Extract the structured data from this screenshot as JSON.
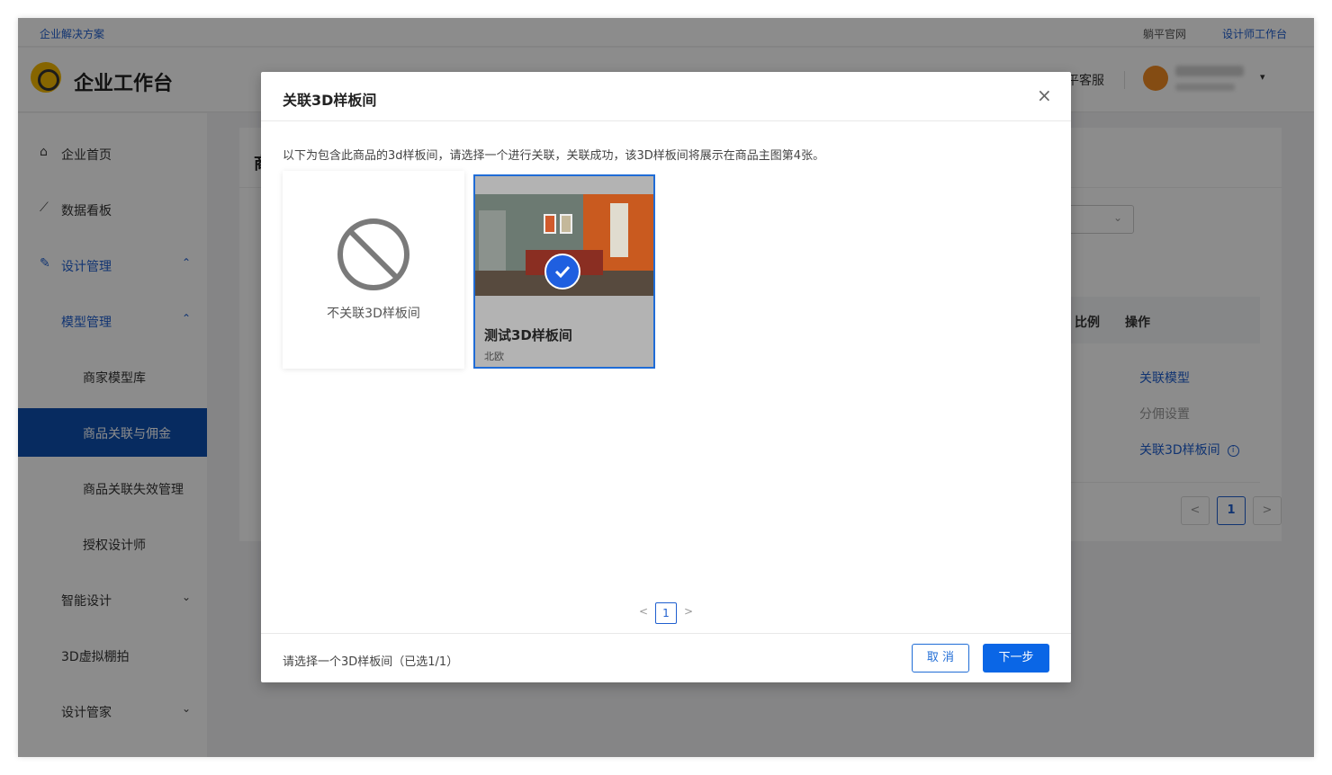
{
  "topstrip": {
    "left_link": "企业解决方案",
    "right_link_1": "躺平官网",
    "right_link_2": "设计师工作台"
  },
  "header": {
    "brand": "企业工作台",
    "service": "平客服",
    "caret": "▾"
  },
  "sidebar": {
    "items": [
      {
        "icon": "home-icon",
        "label": "企业首页",
        "arrow": ""
      },
      {
        "icon": "chart-icon",
        "label": "数据看板",
        "arrow": ""
      },
      {
        "icon": "design-icon",
        "label": "设计管理",
        "arrow": "⌃"
      },
      {
        "icon": "",
        "label": "模型管理",
        "arrow": "⌃"
      },
      {
        "icon": "",
        "label": "商家模型库",
        "arrow": ""
      },
      {
        "icon": "",
        "label": "商品关联与佣金",
        "arrow": ""
      },
      {
        "icon": "",
        "label": "商品关联失效管理",
        "arrow": ""
      },
      {
        "icon": "",
        "label": "授权设计师",
        "arrow": ""
      },
      {
        "icon": "",
        "label": "智能设计",
        "arrow": "⌄"
      },
      {
        "icon": "",
        "label": "3D虚拟棚拍",
        "arrow": ""
      },
      {
        "icon": "",
        "label": "设计管家",
        "arrow": "⌄"
      }
    ]
  },
  "content": {
    "title_partial": "商",
    "table_headers": [
      "比例",
      "操作"
    ],
    "operations": {
      "link_model": "关联模型",
      "commission": "分佣设置",
      "link_room": "关联3D样板间"
    },
    "pagination": {
      "prev": "<",
      "current": "1",
      "next": ">"
    }
  },
  "modal": {
    "title": "关联3D样板间",
    "close": "×",
    "description": "以下为包含此商品的3d样板间，请选择一个进行关联，关联成功，该3D样板间将展示在商品主图第4张。",
    "none_card_label": "不关联3D样板间",
    "room_card": {
      "name": "测试3D样板间",
      "style": "北欧",
      "selected": true
    },
    "pager": {
      "prev": "<",
      "current": "1",
      "next": ">"
    },
    "footer_hint": "请选择一个3D样板间（已选1/1）",
    "cancel_label": "取 消",
    "next_label": "下一步"
  },
  "colors": {
    "accent": "#1f5fcf",
    "primary_button": "#0a66e6",
    "sidebar_active": "#0d4fb0"
  }
}
